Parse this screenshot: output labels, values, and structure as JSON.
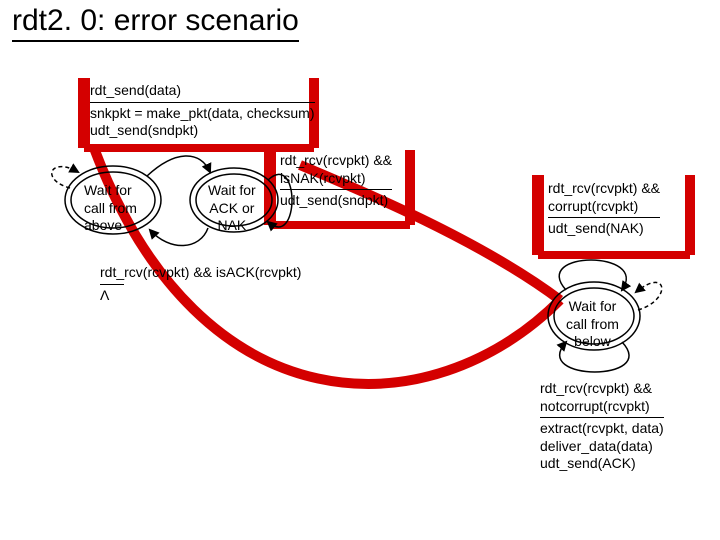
{
  "title": "rdt2. 0: error scenario",
  "sender": {
    "event_send": {
      "trigger": "rdt_send(data)",
      "action1": "snkpkt = make_pkt(data, checksum)",
      "action2": "udt_send(sndpkt)"
    },
    "state_wait_call": {
      "l1": "Wait for",
      "l2": "call from",
      "l3": "above"
    },
    "state_wait_ack": {
      "l1": "Wait for",
      "l2": "ACK or",
      "l3": "NAK"
    },
    "event_nak": {
      "trigger1": "rdt_rcv(rcvpkt) &&",
      "trigger2": "isNAK(rcvpkt)",
      "action": "udt_send(sndpkt)"
    },
    "event_ack": {
      "trigger": "rdt_rcv(rcvpkt) && isACK(rcvpkt)",
      "action": "Λ"
    }
  },
  "receiver": {
    "state_wait_below": {
      "l1": "Wait for",
      "l2": "call from",
      "l3": "below"
    },
    "event_corrupt": {
      "trigger1": "rdt_rcv(rcvpkt) &&",
      "trigger2": "corrupt(rcvpkt)",
      "action": "udt_send(NAK)"
    },
    "event_ok": {
      "trigger1": "rdt_rcv(rcvpkt) &&",
      "trigger2": "notcorrupt(rcvpkt)",
      "action1": "extract(rcvpkt, data)",
      "action2": "deliver_data(data)",
      "action3": "udt_send(ACK)"
    }
  }
}
